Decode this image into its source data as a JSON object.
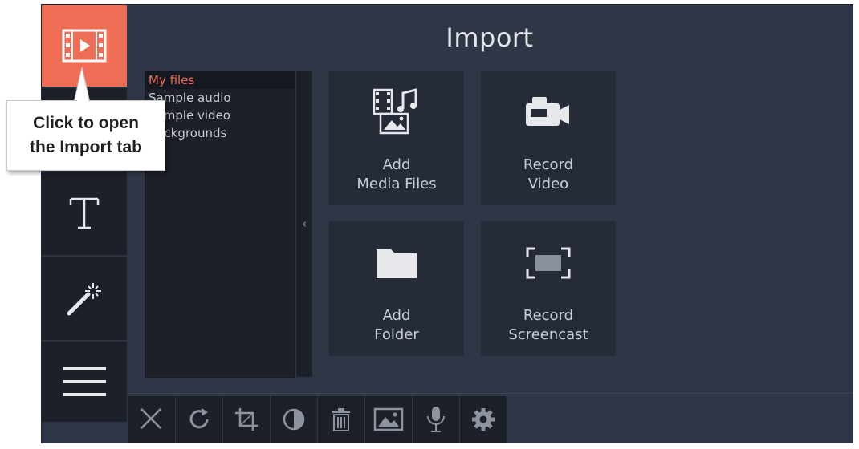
{
  "header": {
    "title": "Import"
  },
  "sidebar": {
    "tabs": [
      {
        "name": "import",
        "icon": "film-play-icon",
        "active": true
      },
      {
        "name": "titles",
        "icon": "text-t-icon"
      },
      {
        "name": "effects",
        "icon": "magic-wand-icon"
      },
      {
        "name": "more",
        "icon": "hamburger-menu-icon"
      }
    ]
  },
  "file_list": {
    "items": [
      "My files",
      "Sample audio",
      "Sample video",
      "Backgrounds"
    ],
    "selected": "My files",
    "collapse_glyph": "‹"
  },
  "tiles": {
    "add_media": {
      "line1": "Add",
      "line2": "Media Files",
      "icon": "media-files-icon"
    },
    "record_video": {
      "line1": "Record",
      "line2": "Video",
      "icon": "camera-icon"
    },
    "add_folder": {
      "line1": "Add",
      "line2": "Folder",
      "icon": "folder-icon"
    },
    "record_screencast": {
      "line1": "Record",
      "line2": "Screencast",
      "icon": "screencast-icon"
    }
  },
  "toolbar": {
    "buttons": [
      "scissors-icon",
      "rotate-icon",
      "crop-icon",
      "color-adjust-icon",
      "trash-icon",
      "image-icon",
      "microphone-icon",
      "settings-icon"
    ]
  },
  "callout": {
    "line1": "Click to open",
    "line2": "the Import tab"
  },
  "colors": {
    "accent": "#ef6c55",
    "background": "#2f3645",
    "panel": "#1c2029",
    "tile": "#252b37"
  }
}
